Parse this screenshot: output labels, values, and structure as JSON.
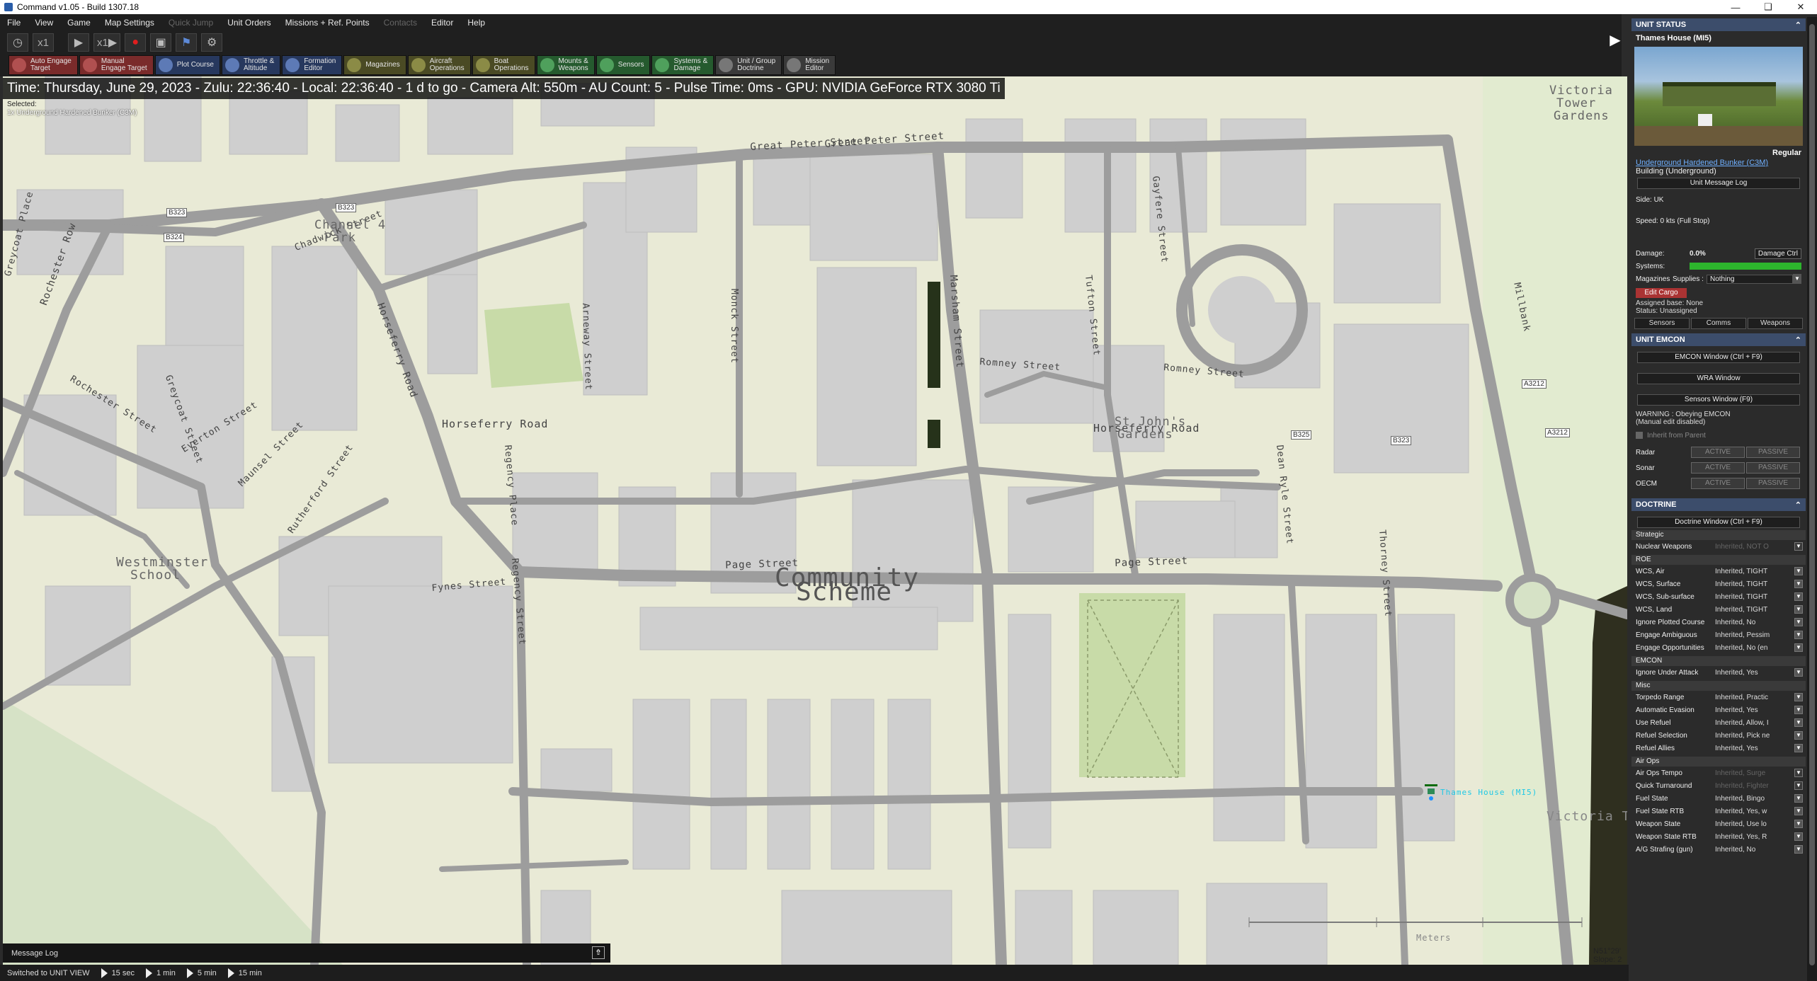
{
  "window": {
    "title": "Command v1.05 - Build 1307.18"
  },
  "menu": [
    "File",
    "View",
    "Game",
    "Map Settings",
    "Quick Jump",
    "Unit Orders",
    "Missions + Ref. Points",
    "Contacts",
    "Editor",
    "Help"
  ],
  "menu_disabled": [
    "Quick Jump",
    "Contacts"
  ],
  "transport": {
    "speed1": "x1",
    "speed2": "x1"
  },
  "toolbar": [
    {
      "label": "Auto Engage\nTarget",
      "style": "red",
      "icon": "crosshair-icon"
    },
    {
      "label": "Manual\nEngage Target",
      "style": "red",
      "icon": "target-icon"
    },
    {
      "label": "Plot Course",
      "style": "blue",
      "icon": "course-icon"
    },
    {
      "label": "Throttle &\nAltitude",
      "style": "blue",
      "icon": "throttle-icon"
    },
    {
      "label": "Formation\nEditor",
      "style": "blue",
      "icon": "formation-icon"
    },
    {
      "label": "Magazines",
      "style": "olive",
      "icon": "magazine-icon"
    },
    {
      "label": "Aircraft\nOperations",
      "style": "olive",
      "icon": "aircraft-icon"
    },
    {
      "label": "Boat\nOperations",
      "style": "olive",
      "icon": "boat-icon"
    },
    {
      "label": "Mounts &\nWeapons",
      "style": "green",
      "icon": "weapons-icon"
    },
    {
      "label": "Sensors",
      "style": "green",
      "icon": "sensor-icon"
    },
    {
      "label": "Systems &\nDamage",
      "style": "green",
      "icon": "gear-icon"
    },
    {
      "label": "Unit / Group\nDoctrine",
      "style": "grey",
      "icon": "doctrine-icon"
    },
    {
      "label": "Mission\nEditor",
      "style": "grey",
      "icon": "mission-icon"
    }
  ],
  "infobar": "Time: Thursday, June 29, 2023 - Zulu: 22:36:40 - Local: 22:36:40 - 1 d to go -  Camera Alt: 550m  - AU Count: 5 - Pulse Time: 0ms - GPU: NVIDIA GeForce RTX 3080 Ti",
  "selected": {
    "label": "Selected:",
    "unit": "1x Underground Hardened Bunker (C3M)"
  },
  "map": {
    "labels": [
      {
        "text": "Great Peter Street"
      },
      {
        "text": "Great Peter Street"
      },
      {
        "text": "Chadwick Street"
      },
      {
        "text": "Channel 4"
      },
      {
        "text": "Park"
      },
      {
        "text": "Horseferry Road"
      },
      {
        "text": "Horseferry Road"
      },
      {
        "text": "Horseferry Road"
      },
      {
        "text": "Romney Street"
      },
      {
        "text": "Romney Street"
      },
      {
        "text": "Marsham Street"
      },
      {
        "text": "Monck Street"
      },
      {
        "text": "Tufton Street"
      },
      {
        "text": "Gayfere Street"
      },
      {
        "text": "Victoria"
      },
      {
        "text": "Tower"
      },
      {
        "text": "Gardens"
      },
      {
        "text": "St John's"
      },
      {
        "text": "Gardens"
      },
      {
        "text": "Page Street"
      },
      {
        "text": "Page Street"
      },
      {
        "text": "Rochester Row"
      },
      {
        "text": "Rochester Street"
      },
      {
        "text": "Greycoat Place"
      },
      {
        "text": "Greycoat Street"
      },
      {
        "text": "Regency Place"
      },
      {
        "text": "Regency Street"
      },
      {
        "text": "Everton Street"
      },
      {
        "text": "Maunsel Street"
      },
      {
        "text": "Rutherford Street"
      },
      {
        "text": "Fynes Street"
      },
      {
        "text": "Westminster"
      },
      {
        "text": "School"
      },
      {
        "text": "Community"
      },
      {
        "text": "Scheme"
      },
      {
        "text": "Millbank"
      },
      {
        "text": "Dean Ryle Street"
      },
      {
        "text": "Thorney Street"
      },
      {
        "text": "Arneway Street"
      },
      {
        "text": "Thames House (MI5)"
      },
      {
        "text": "B323"
      },
      {
        "text": "B323"
      },
      {
        "text": "B324"
      },
      {
        "text": "B325"
      },
      {
        "text": "B323"
      },
      {
        "text": "A3212"
      },
      {
        "text": "A3212"
      },
      {
        "text": "Meters"
      },
      {
        "text": "Victoria Tower Gardens South"
      }
    ],
    "coordinates": {
      "lat": "N51°29'",
      "slope": "Slope: 2"
    }
  },
  "message_log": {
    "title": "Message Log"
  },
  "statusbar": {
    "text": "Switched to UNIT VIEW",
    "steps": [
      "15 sec",
      "1 min",
      "5 min",
      "15 min"
    ]
  },
  "panel": {
    "unit_status": {
      "header": "UNIT STATUS",
      "name": "Thames House (MI5)",
      "proficiency": "Regular",
      "class_link": "Underground Hardened Bunker (C3M)",
      "type": "Building (Underground)",
      "msg_log_btn": "Unit Message Log",
      "side": "Side: UK",
      "speed": "Speed: 0 kts (Full Stop)",
      "damage_label": "Damage:",
      "damage_value": "0.0%",
      "damage_ctrl": "Damage Ctrl",
      "systems_label": "Systems:",
      "magazines": "Magazines",
      "supplies_label": "Supplies :",
      "supplies_value": "Nothing",
      "edit_cargo": "Edit Cargo",
      "assigned_base": "Assigned base: None",
      "status": "Status: Unassigned",
      "tabs": [
        "Sensors",
        "Comms",
        "Weapons"
      ]
    },
    "emcon": {
      "header": "UNIT EMCON",
      "btn1": "EMCON Window (Ctrl + F9)",
      "btn2": "WRA Window",
      "btn3": "Sensors Window (F9)",
      "warning1": "WARNING : Obeying EMCON",
      "warning2": "(Manual edit disabled)",
      "inherit": "Inherit from Parent",
      "rows": [
        {
          "name": "Radar"
        },
        {
          "name": "Sonar"
        },
        {
          "name": "OECM"
        }
      ],
      "active": "ACTIVE",
      "passive": "PASSIVE"
    },
    "doctrine": {
      "header": "DOCTRINE",
      "btn": "Doctrine Window (Ctrl + F9)",
      "sections": [
        {
          "title": "Strategic",
          "rows": [
            {
              "k": "Nuclear Weapons",
              "v": "Inherited, NOT O",
              "dim": true
            }
          ]
        },
        {
          "title": "ROE",
          "rows": [
            {
              "k": "WCS, Air",
              "v": "Inherited, TIGHT"
            },
            {
              "k": "WCS, Surface",
              "v": "Inherited, TIGHT"
            },
            {
              "k": "WCS, Sub-surface",
              "v": "Inherited, TIGHT"
            },
            {
              "k": "WCS, Land",
              "v": "Inherited, TIGHT"
            },
            {
              "k": "Ignore Plotted Course",
              "v": "Inherited, No"
            },
            {
              "k": "Engage Ambiguous",
              "v": "Inherited, Pessim"
            },
            {
              "k": "Engage Opportunities",
              "v": "Inherited, No (en"
            }
          ]
        },
        {
          "title": "EMCON",
          "rows": [
            {
              "k": "Ignore Under Attack",
              "v": "Inherited, Yes"
            }
          ]
        },
        {
          "title": "Misc",
          "rows": [
            {
              "k": "Torpedo Range",
              "v": "Inherited, Practic"
            },
            {
              "k": "Automatic Evasion",
              "v": "Inherited, Yes"
            },
            {
              "k": "Use Refuel",
              "v": "Inherited, Allow, I"
            },
            {
              "k": "Refuel Selection",
              "v": "Inherited, Pick ne"
            },
            {
              "k": "Refuel Allies",
              "v": "Inherited, Yes"
            }
          ]
        },
        {
          "title": "Air Ops",
          "rows": [
            {
              "k": "Air Ops Tempo",
              "v": "Inherited, Surge",
              "dim": true
            },
            {
              "k": "Quick Turnaround",
              "v": "Inherited, Fighter",
              "dim": true
            },
            {
              "k": "Fuel State",
              "v": "Inherited, Bingo"
            },
            {
              "k": "Fuel State RTB",
              "v": "Inherited, Yes, w"
            },
            {
              "k": "Weapon State",
              "v": "Inherited, Use lo"
            },
            {
              "k": "Weapon State RTB",
              "v": "Inherited, Yes, R"
            },
            {
              "k": "A/G Strafing (gun)",
              "v": "Inherited, No"
            }
          ]
        }
      ]
    }
  },
  "colors": {
    "accent": "#3c4d6b",
    "systems_bar": "#2db52d",
    "map_bg": "#e9ead6",
    "road": "#9d9d9d",
    "building": "#cfcfcf",
    "park": "#c8dba8"
  }
}
